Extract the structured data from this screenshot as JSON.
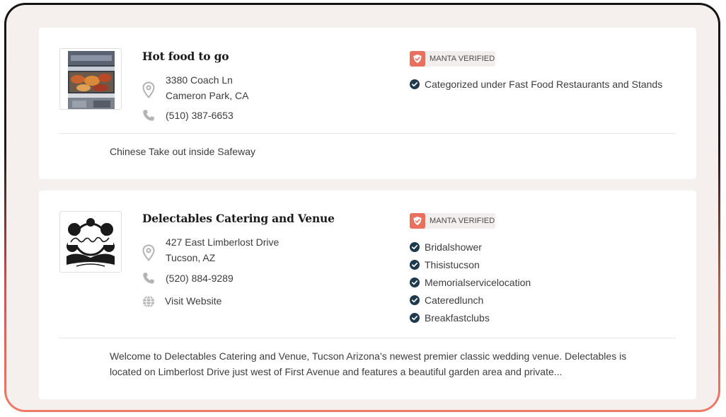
{
  "listings": [
    {
      "name": "Hot food to go",
      "address_line1": "3380 Coach Ln",
      "address_line2": "Cameron Park, CA",
      "phone": "(510) 387-6653",
      "badge": "MANTA VERIFIED",
      "categories": [
        "Categorized under Fast Food Restaurants and Stands"
      ],
      "description": "Chinese Take out inside Safeway",
      "icons": {
        "address": "map-pin-icon",
        "phone": "phone-icon",
        "check": "check-circle-icon"
      }
    },
    {
      "name": "Delectables Catering and Venue",
      "address_line1": "427 East Limberlost Drive",
      "address_line2": "Tucson, AZ",
      "phone": "(520) 884-9289",
      "website_label": "Visit Website",
      "badge": "MANTA VERIFIED",
      "categories": [
        "Bridalshower",
        "Thisistucson",
        "Memorialservicelocation",
        "Cateredlunch",
        "Breakfastclubs"
      ],
      "description": "Welcome to Delectables Catering and Venue, Tucson Arizona’s newest premier classic wedding venue. Delectables is located on Limberlost Drive just west of First Avenue and features a beautiful garden area and private...",
      "icons": {
        "address": "map-pin-icon",
        "phone": "phone-icon",
        "website": "globe-icon",
        "check": "check-circle-icon"
      }
    }
  ],
  "colors": {
    "accent": "#e8705e",
    "check": "#1f3a4d",
    "icon_grey": "#b3b3b3",
    "text": "#3c3c3c",
    "card_bg": "#ffffff",
    "page_bg": "#f5efee"
  }
}
